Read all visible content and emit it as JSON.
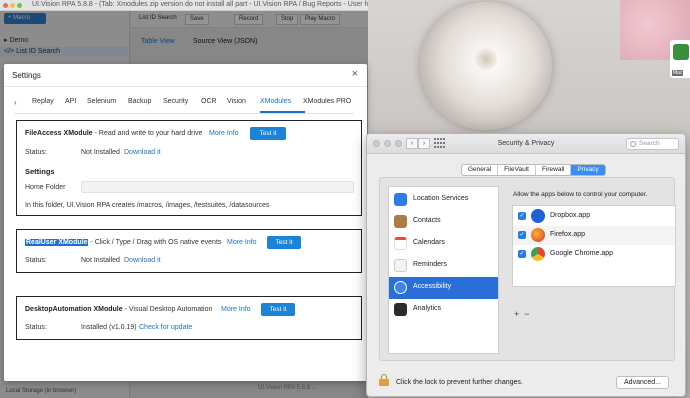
{
  "app": {
    "window_title": "UI.Vision RPA 5.8.8 - (Tab: Xmodules zip version do not install all part - UI.Vision RPA / Bug Reports - User forum f...",
    "macro_button": "+ Macro",
    "tree": {
      "folder": "Demo",
      "selected_item": "List ID Search"
    },
    "toolbar": {
      "macro_name": "List ID Search",
      "save": "Save",
      "record": "Record",
      "stop": "Stop",
      "play_macro": "Play Macro"
    },
    "tabs": {
      "table_view": "Table View",
      "source_view": "Source View (JSON)"
    },
    "local_storage": "Local Storage (in browser)",
    "footer_text": "UI.Vision RPA 5.8.8 ..."
  },
  "settings": {
    "title": "Settings",
    "close_glyph": "×",
    "tabs": [
      "Replay",
      "API",
      "Selenium",
      "Backup",
      "Security",
      "OCR",
      "Vision",
      "XModules",
      "XModules PRO"
    ],
    "active_tab": "XModules",
    "fileaccess": {
      "name": "FileAccess XModule",
      "desc": " - Read and write to your hard drive",
      "more_info": "More Info",
      "test_it": "Test it",
      "status_label": "Status:",
      "status_value": "Not Installed",
      "download": "Download it",
      "settings_heading": "Settings",
      "home_folder_label": "Home Folder",
      "home_folder_value": "",
      "note": "In this folder, UI.Vision RPA creates /macros, /images, /testsuites, /datasources"
    },
    "realuser": {
      "name": "RealUser XModule",
      "desc": " - Click / Type / Drag with OS native events",
      "more_info": "More Info",
      "test_it": "Test it",
      "status_label": "Status:",
      "status_value": "Not Installed",
      "download": "Download it"
    },
    "desktop": {
      "name": "DesktopAutomation XModule",
      "desc": " - Visual Desktop Automation",
      "more_info": "More Info",
      "test_it": "Test it",
      "status_label": "Status:",
      "status_value": "Installed (v1.0.19)",
      "check_update": "Check for update"
    }
  },
  "security": {
    "title": "Security & Privacy",
    "search_placeholder": "Search",
    "segments": [
      "General",
      "FileVault",
      "Firewall",
      "Privacy"
    ],
    "active_segment": "Privacy",
    "services": [
      {
        "label": "Location Services",
        "icon": "location-icon",
        "color": "#2b7de9"
      },
      {
        "label": "Contacts",
        "icon": "contacts-icon",
        "color": "#b07a45"
      },
      {
        "label": "Calendars",
        "icon": "calendar-icon",
        "color": "#f04a3c"
      },
      {
        "label": "Reminders",
        "icon": "reminders-icon",
        "color": "#f3f3f3"
      },
      {
        "label": "Accessibility",
        "icon": "accessibility-icon",
        "color": "#3b86e8"
      },
      {
        "label": "Analytics",
        "icon": "analytics-icon",
        "color": "#2b2b2b"
      }
    ],
    "selected_service": "Accessibility",
    "allow_text": "Allow the apps below to control your computer.",
    "apps": [
      {
        "label": "Dropbox.app",
        "checked": true,
        "icon": "dropbox-icon",
        "color": "#1f62d8"
      },
      {
        "label": "Firefox.app",
        "checked": true,
        "icon": "firefox-icon",
        "color": "#e8672a"
      },
      {
        "label": "Google Chrome.app",
        "checked": true,
        "icon": "chrome-icon",
        "color": "#3da454"
      }
    ],
    "add_glyph": "+",
    "remove_glyph": "−",
    "lock_text": "Click the lock to prevent further changes.",
    "advanced": "Advanced..."
  }
}
